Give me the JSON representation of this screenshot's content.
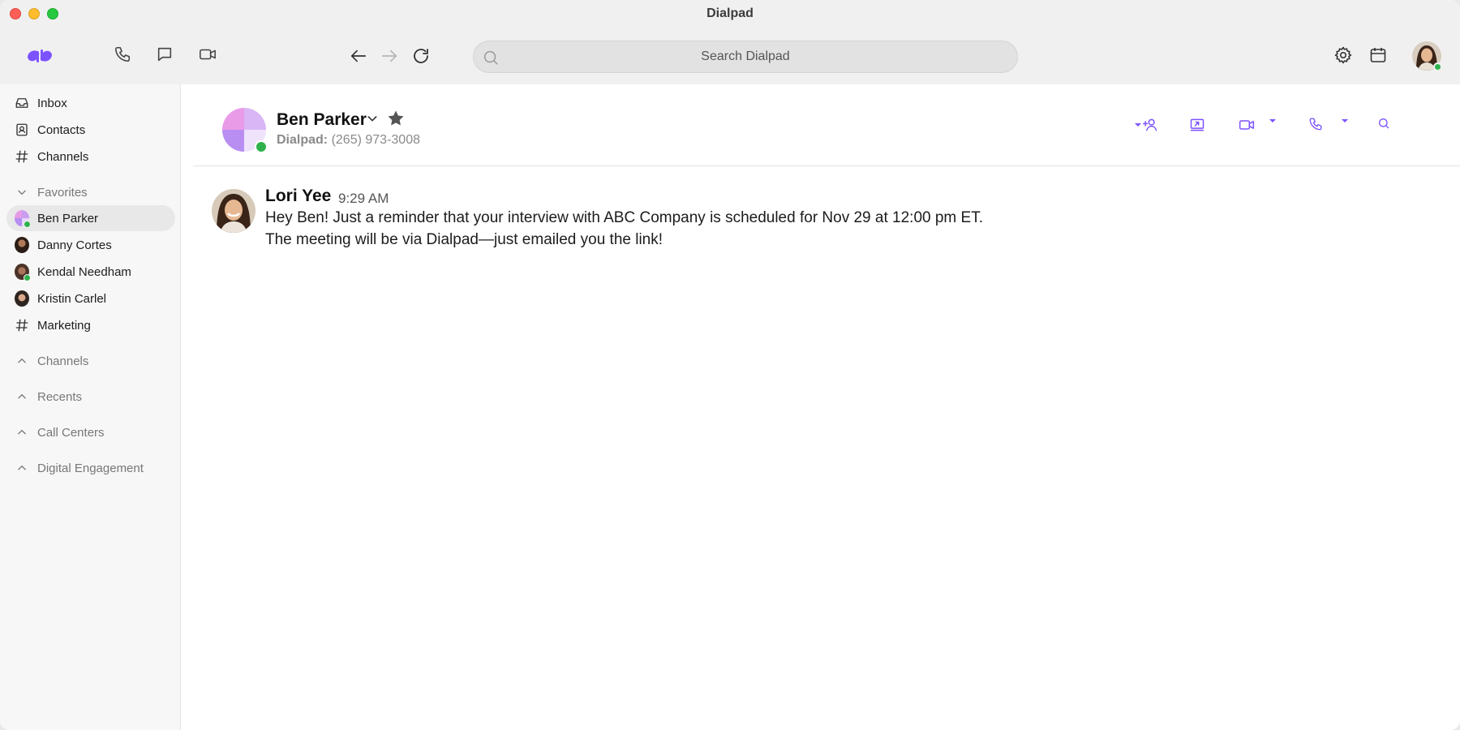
{
  "window": {
    "title": "Dialpad"
  },
  "toolbar": {
    "search_placeholder": "Search Dialpad"
  },
  "sidebar": {
    "top_items": [
      {
        "label": "Inbox",
        "icon": "inbox-icon"
      },
      {
        "label": "Contacts",
        "icon": "contacts-icon"
      },
      {
        "label": "Channels",
        "icon": "hash-icon"
      }
    ],
    "favorites": {
      "label": "Favorites",
      "items": [
        {
          "label": "Ben Parker",
          "selected": true,
          "online": true
        },
        {
          "label": "Danny Cortes",
          "selected": false,
          "online": false
        },
        {
          "label": "Kendal Needham",
          "selected": false,
          "online": true
        },
        {
          "label": "Kristin Carlel",
          "selected": false,
          "online": false
        },
        {
          "label": "Marketing",
          "selected": false,
          "online": false
        }
      ]
    },
    "sections": [
      {
        "label": "Channels"
      },
      {
        "label": "Recents"
      },
      {
        "label": "Call Centers"
      },
      {
        "label": "Digital Engagement"
      }
    ]
  },
  "conversation": {
    "contact_name": "Ben Parker",
    "contact_source_label": "Dialpad:",
    "contact_phone": "(265) 973-3008",
    "messages": [
      {
        "author": "Lori Yee",
        "time": "9:29 AM",
        "lines": [
          "Hey Ben! Just a reminder that your interview with ABC Company is scheduled for Nov 29 at 12:00 pm ET.",
          "The meeting will be via Dialpad—just emailed you the link!"
        ]
      }
    ]
  },
  "colors": {
    "accent": "#7c52ff",
    "online": "#2fb24c",
    "sidebar_bg": "#f7f7f7",
    "toolbar_bg": "#f0f0f0"
  }
}
